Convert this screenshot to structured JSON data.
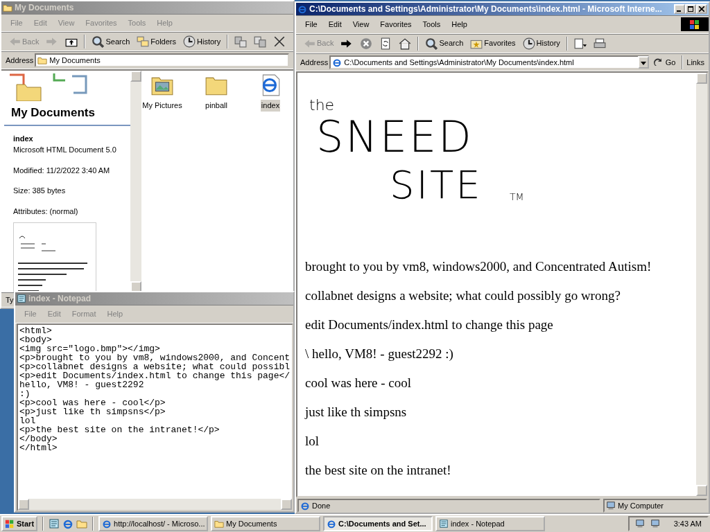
{
  "explorer": {
    "title": "My Documents",
    "active": false,
    "menu": [
      "File",
      "Edit",
      "View",
      "Favorites",
      "Tools",
      "Help"
    ],
    "toolbar": [
      {
        "kind": "back",
        "label": "Back",
        "disabled": true
      },
      {
        "kind": "forward",
        "disabled": true
      },
      {
        "kind": "up",
        "disabled": false
      },
      {
        "kind": "search",
        "label": "Search",
        "disabled": false
      },
      {
        "kind": "folders",
        "label": "Folders",
        "disabled": false
      },
      {
        "kind": "history",
        "label": "History",
        "disabled": false
      },
      {
        "kind": "move",
        "disabled": false
      },
      {
        "kind": "copy",
        "disabled": false
      },
      {
        "kind": "delete",
        "disabled": false
      }
    ],
    "address_label": "Address",
    "address": "My Documents",
    "panel_title": "My Documents",
    "file_name": "index",
    "file_type": "Microsoft HTML Document 5.0",
    "modified": "Modified: 11/2/2022 3:40 AM",
    "size": "Size: 385 bytes",
    "attributes": "Attributes: (normal)",
    "files": [
      {
        "name": "My Pictures",
        "kind": "photo-folder",
        "selected": false
      },
      {
        "name": "pinball",
        "kind": "folder",
        "selected": false
      },
      {
        "name": "index",
        "kind": "web-page",
        "selected": true
      }
    ],
    "status_fragment": "Ty"
  },
  "notepad": {
    "title": "index - Notepad",
    "active": false,
    "menu": [
      "File",
      "Edit",
      "Format",
      "Help"
    ],
    "lines": [
      "<html>",
      "<body>",
      "<img src=\"logo.bmp\"></img>",
      "<p>brought to you by vm8, windows2000, and Concent",
      "<p>collabnet designs a website; what could possibl",
      "<p>edit Documents/index.html to change this page</",
      "hello, VM8! - guest2292",
      ":)",
      "<p>cool was here - cool</p>",
      "<p>just like th simpsns</p>",
      "lol",
      "<p>the best site on the intranet!</p>",
      "</body>",
      "</html>"
    ]
  },
  "browser": {
    "title": "C:\\Documents and Settings\\Administrator\\My Documents\\index.html - Microsoft Interne...",
    "active": true,
    "menu": [
      "File",
      "Edit",
      "View",
      "Favorites",
      "Tools",
      "Help"
    ],
    "toolbar": [
      {
        "kind": "back",
        "label": "Back",
        "disabled": true
      },
      {
        "kind": "forward",
        "disabled": false
      },
      {
        "kind": "stop",
        "disabled": false
      },
      {
        "kind": "refresh",
        "disabled": false
      },
      {
        "kind": "home",
        "disabled": false
      },
      {
        "kind": "search",
        "label": "Search",
        "disabled": false
      },
      {
        "kind": "favorites",
        "label": "Favorites",
        "disabled": false
      },
      {
        "kind": "history",
        "label": "History",
        "disabled": false
      },
      {
        "kind": "mail",
        "disabled": false
      },
      {
        "kind": "print",
        "disabled": false
      }
    ],
    "address_label": "Address",
    "address": "C:\\Documents and Settings\\Administrator\\My Documents\\index.html",
    "go": "Go",
    "links": "Links",
    "logo": [
      "the",
      "SNEED",
      "SITE",
      "TM"
    ],
    "paragraphs": [
      "brought to you by vm8, windows2000, and Concentrated Autism!",
      "collabnet designs a website; what could possibly go wrong?",
      "edit Documents/index.html to change this page",
      "\\ hello, VM8! - guest2292 :)",
      "cool was here - cool",
      "just like th simpsns",
      "lol",
      "the best site on the intranet!"
    ],
    "status": "Done",
    "zone": "My Computer"
  },
  "taskbar": {
    "start": "Start",
    "tasks": [
      {
        "kind": "browser",
        "label": "http://localhost/ - Microso...",
        "selected": false
      },
      {
        "kind": "folder",
        "label": "My Documents",
        "selected": false
      },
      {
        "kind": "browser",
        "label": "C:\\Documents and Set...",
        "selected": true
      },
      {
        "kind": "notepad",
        "label": "index - Notepad",
        "selected": false
      }
    ],
    "clock": "3:43 AM"
  }
}
